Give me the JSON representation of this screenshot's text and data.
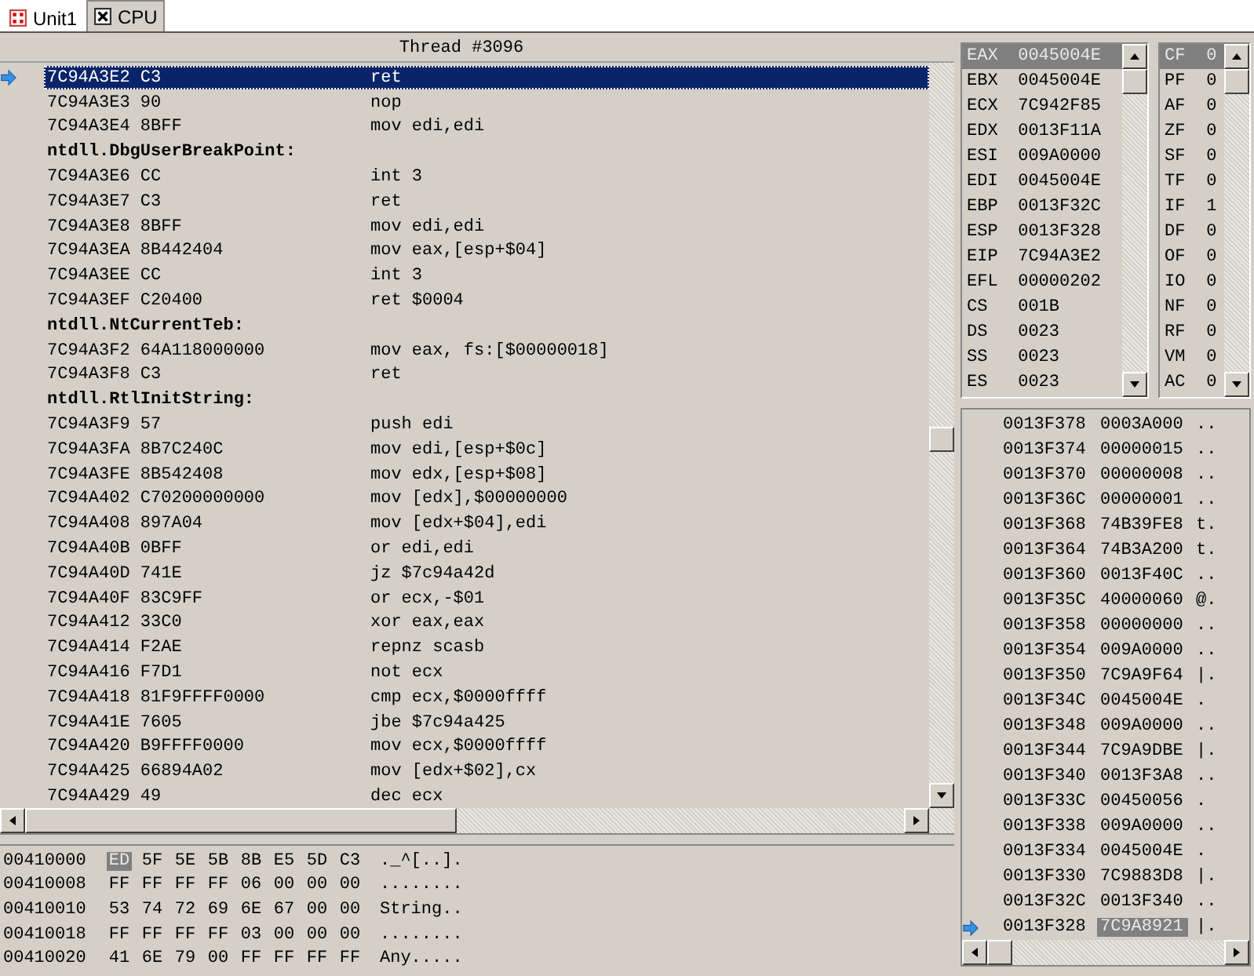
{
  "tabs": [
    {
      "label": "Unit1",
      "kind": "unit",
      "selected": false
    },
    {
      "label": "CPU",
      "kind": "cpu",
      "selected": true
    }
  ],
  "disassembly": {
    "title": "Thread #3096",
    "rows": [
      {
        "kind": "instr",
        "address": "7C94A3E2",
        "bytes": "C3",
        "instruction": "ret",
        "current": true,
        "selected": true
      },
      {
        "kind": "instr",
        "address": "7C94A3E3",
        "bytes": "90",
        "instruction": "nop",
        "current": false,
        "selected": false
      },
      {
        "kind": "instr",
        "address": "7C94A3E4",
        "bytes": "8BFF",
        "instruction": "mov edi,edi",
        "current": false,
        "selected": false
      },
      {
        "kind": "label",
        "text": "ntdll.DbgUserBreakPoint:",
        "current": false,
        "selected": false
      },
      {
        "kind": "instr",
        "address": "7C94A3E6",
        "bytes": "CC",
        "instruction": "int 3",
        "current": false,
        "selected": false
      },
      {
        "kind": "instr",
        "address": "7C94A3E7",
        "bytes": "C3",
        "instruction": "ret",
        "current": false,
        "selected": false
      },
      {
        "kind": "instr",
        "address": "7C94A3E8",
        "bytes": "8BFF",
        "instruction": "mov edi,edi",
        "current": false,
        "selected": false
      },
      {
        "kind": "instr",
        "address": "7C94A3EA",
        "bytes": "8B442404",
        "instruction": "mov eax,[esp+$04]",
        "current": false,
        "selected": false
      },
      {
        "kind": "instr",
        "address": "7C94A3EE",
        "bytes": "CC",
        "instruction": "int 3",
        "current": false,
        "selected": false
      },
      {
        "kind": "instr",
        "address": "7C94A3EF",
        "bytes": "C20400",
        "instruction": "ret $0004",
        "current": false,
        "selected": false
      },
      {
        "kind": "label",
        "text": "ntdll.NtCurrentTeb:",
        "current": false,
        "selected": false
      },
      {
        "kind": "instr",
        "address": "7C94A3F2",
        "bytes": "64A118000000",
        "instruction": "mov eax, fs:[$00000018]",
        "current": false,
        "selected": false
      },
      {
        "kind": "instr",
        "address": "7C94A3F8",
        "bytes": "C3",
        "instruction": "ret",
        "current": false,
        "selected": false
      },
      {
        "kind": "label",
        "text": "ntdll.RtlInitString:",
        "current": false,
        "selected": false
      },
      {
        "kind": "instr",
        "address": "7C94A3F9",
        "bytes": "57",
        "instruction": "push edi",
        "current": false,
        "selected": false
      },
      {
        "kind": "instr",
        "address": "7C94A3FA",
        "bytes": "8B7C240C",
        "instruction": "mov edi,[esp+$0c]",
        "current": false,
        "selected": false
      },
      {
        "kind": "instr",
        "address": "7C94A3FE",
        "bytes": "8B542408",
        "instruction": "mov edx,[esp+$08]",
        "current": false,
        "selected": false
      },
      {
        "kind": "instr",
        "address": "7C94A402",
        "bytes": "C70200000000",
        "instruction": "mov [edx],$00000000",
        "current": false,
        "selected": false
      },
      {
        "kind": "instr",
        "address": "7C94A408",
        "bytes": "897A04",
        "instruction": "mov [edx+$04],edi",
        "current": false,
        "selected": false
      },
      {
        "kind": "instr",
        "address": "7C94A40B",
        "bytes": "0BFF",
        "instruction": "or edi,edi",
        "current": false,
        "selected": false
      },
      {
        "kind": "instr",
        "address": "7C94A40D",
        "bytes": "741E",
        "instruction": "jz $7c94a42d",
        "current": false,
        "selected": false
      },
      {
        "kind": "instr",
        "address": "7C94A40F",
        "bytes": "83C9FF",
        "instruction": "or ecx,-$01",
        "current": false,
        "selected": false
      },
      {
        "kind": "instr",
        "address": "7C94A412",
        "bytes": "33C0",
        "instruction": "xor eax,eax",
        "current": false,
        "selected": false
      },
      {
        "kind": "instr",
        "address": "7C94A414",
        "bytes": "F2AE",
        "instruction": "repnz scasb",
        "current": false,
        "selected": false
      },
      {
        "kind": "instr",
        "address": "7C94A416",
        "bytes": "F7D1",
        "instruction": "not ecx",
        "current": false,
        "selected": false
      },
      {
        "kind": "instr",
        "address": "7C94A418",
        "bytes": "81F9FFFF0000",
        "instruction": "cmp ecx,$0000ffff",
        "current": false,
        "selected": false
      },
      {
        "kind": "instr",
        "address": "7C94A41E",
        "bytes": "7605",
        "instruction": "jbe $7c94a425",
        "current": false,
        "selected": false
      },
      {
        "kind": "instr",
        "address": "7C94A420",
        "bytes": "B9FFFF0000",
        "instruction": "mov ecx,$0000ffff",
        "current": false,
        "selected": false
      },
      {
        "kind": "instr",
        "address": "7C94A425",
        "bytes": "66894A02",
        "instruction": "mov [edx+$02],cx",
        "current": false,
        "selected": false
      },
      {
        "kind": "instr",
        "address": "7C94A429",
        "bytes": "49",
        "instruction": "dec ecx",
        "current": false,
        "selected": false
      }
    ]
  },
  "registers": [
    {
      "name": "EAX",
      "value": "0045004E",
      "selected": true
    },
    {
      "name": "EBX",
      "value": "0045004E",
      "selected": false
    },
    {
      "name": "ECX",
      "value": "7C942F85",
      "selected": false
    },
    {
      "name": "EDX",
      "value": "0013F11A",
      "selected": false
    },
    {
      "name": "ESI",
      "value": "009A0000",
      "selected": false
    },
    {
      "name": "EDI",
      "value": "0045004E",
      "selected": false
    },
    {
      "name": "EBP",
      "value": "0013F32C",
      "selected": false
    },
    {
      "name": "ESP",
      "value": "0013F328",
      "selected": false
    },
    {
      "name": "EIP",
      "value": "7C94A3E2",
      "selected": false
    },
    {
      "name": "EFL",
      "value": "00000202",
      "selected": false
    },
    {
      "name": "CS",
      "value": "001B",
      "selected": false
    },
    {
      "name": "DS",
      "value": "0023",
      "selected": false
    },
    {
      "name": "SS",
      "value": "0023",
      "selected": false
    },
    {
      "name": "ES",
      "value": "0023",
      "selected": false
    }
  ],
  "flags": [
    {
      "name": "CF",
      "value": "0",
      "selected": true
    },
    {
      "name": "PF",
      "value": "0",
      "selected": false
    },
    {
      "name": "AF",
      "value": "0",
      "selected": false
    },
    {
      "name": "ZF",
      "value": "0",
      "selected": false
    },
    {
      "name": "SF",
      "value": "0",
      "selected": false
    },
    {
      "name": "TF",
      "value": "0",
      "selected": false
    },
    {
      "name": "IF",
      "value": "1",
      "selected": false
    },
    {
      "name": "DF",
      "value": "0",
      "selected": false
    },
    {
      "name": "OF",
      "value": "0",
      "selected": false
    },
    {
      "name": "IO",
      "value": "0",
      "selected": false
    },
    {
      "name": "NF",
      "value": "0",
      "selected": false
    },
    {
      "name": "RF",
      "value": "0",
      "selected": false
    },
    {
      "name": "VM",
      "value": "0",
      "selected": false
    },
    {
      "name": "AC",
      "value": "0",
      "selected": false
    }
  ],
  "stack": [
    {
      "address": "0013F378",
      "value": "0003A000",
      "ascii": "..",
      "current": false,
      "selected": false
    },
    {
      "address": "0013F374",
      "value": "00000015",
      "ascii": "..",
      "current": false,
      "selected": false
    },
    {
      "address": "0013F370",
      "value": "00000008",
      "ascii": "..",
      "current": false,
      "selected": false
    },
    {
      "address": "0013F36C",
      "value": "00000001",
      "ascii": "..",
      "current": false,
      "selected": false
    },
    {
      "address": "0013F368",
      "value": "74B39FE8",
      "ascii": "t.",
      "current": false,
      "selected": false
    },
    {
      "address": "0013F364",
      "value": "74B3A200",
      "ascii": "t.",
      "current": false,
      "selected": false
    },
    {
      "address": "0013F360",
      "value": "0013F40C",
      "ascii": "..",
      "current": false,
      "selected": false
    },
    {
      "address": "0013F35C",
      "value": "40000060",
      "ascii": "@.",
      "current": false,
      "selected": false
    },
    {
      "address": "0013F358",
      "value": "00000000",
      "ascii": "..",
      "current": false,
      "selected": false
    },
    {
      "address": "0013F354",
      "value": "009A0000",
      "ascii": "..",
      "current": false,
      "selected": false
    },
    {
      "address": "0013F350",
      "value": "7C9A9F64",
      "ascii": "|.",
      "current": false,
      "selected": false
    },
    {
      "address": "0013F34C",
      "value": "0045004E",
      "ascii": ".",
      "current": false,
      "selected": false
    },
    {
      "address": "0013F348",
      "value": "009A0000",
      "ascii": "..",
      "current": false,
      "selected": false
    },
    {
      "address": "0013F344",
      "value": "7C9A9DBE",
      "ascii": "|.",
      "current": false,
      "selected": false
    },
    {
      "address": "0013F340",
      "value": "0013F3A8",
      "ascii": "..",
      "current": false,
      "selected": false
    },
    {
      "address": "0013F33C",
      "value": "00450056",
      "ascii": ".",
      "current": false,
      "selected": false
    },
    {
      "address": "0013F338",
      "value": "009A0000",
      "ascii": "..",
      "current": false,
      "selected": false
    },
    {
      "address": "0013F334",
      "value": "0045004E",
      "ascii": ".",
      "current": false,
      "selected": false
    },
    {
      "address": "0013F330",
      "value": "7C9883D8",
      "ascii": "|.",
      "current": false,
      "selected": false
    },
    {
      "address": "0013F32C",
      "value": "0013F340",
      "ascii": "..",
      "current": false,
      "selected": false
    },
    {
      "address": "0013F328",
      "value": "7C9A8921",
      "ascii": "|.",
      "current": true,
      "selected": true
    }
  ],
  "memory_dump": [
    {
      "address": "00410000",
      "bytes": [
        {
          "text": "ED",
          "selected": true
        },
        {
          "text": "5F",
          "selected": false
        },
        {
          "text": "5E",
          "selected": false
        },
        {
          "text": "5B",
          "selected": false
        },
        {
          "text": "8B",
          "selected": false
        },
        {
          "text": "E5",
          "selected": false
        },
        {
          "text": "5D",
          "selected": false
        },
        {
          "text": "C3",
          "selected": false
        }
      ],
      "ascii": "._^[..]."
    },
    {
      "address": "00410008",
      "bytes": [
        {
          "text": "FF",
          "selected": false
        },
        {
          "text": "FF",
          "selected": false
        },
        {
          "text": "FF",
          "selected": false
        },
        {
          "text": "FF",
          "selected": false
        },
        {
          "text": "06",
          "selected": false
        },
        {
          "text": "00",
          "selected": false
        },
        {
          "text": "00",
          "selected": false
        },
        {
          "text": "00",
          "selected": false
        }
      ],
      "ascii": "........"
    },
    {
      "address": "00410010",
      "bytes": [
        {
          "text": "53",
          "selected": false
        },
        {
          "text": "74",
          "selected": false
        },
        {
          "text": "72",
          "selected": false
        },
        {
          "text": "69",
          "selected": false
        },
        {
          "text": "6E",
          "selected": false
        },
        {
          "text": "67",
          "selected": false
        },
        {
          "text": "00",
          "selected": false
        },
        {
          "text": "00",
          "selected": false
        }
      ],
      "ascii": "String.."
    },
    {
      "address": "00410018",
      "bytes": [
        {
          "text": "FF",
          "selected": false
        },
        {
          "text": "FF",
          "selected": false
        },
        {
          "text": "FF",
          "selected": false
        },
        {
          "text": "FF",
          "selected": false
        },
        {
          "text": "03",
          "selected": false
        },
        {
          "text": "00",
          "selected": false
        },
        {
          "text": "00",
          "selected": false
        },
        {
          "text": "00",
          "selected": false
        }
      ],
      "ascii": "........"
    },
    {
      "address": "00410020",
      "bytes": [
        {
          "text": "41",
          "selected": false
        },
        {
          "text": "6E",
          "selected": false
        },
        {
          "text": "79",
          "selected": false
        },
        {
          "text": "00",
          "selected": false
        },
        {
          "text": "FF",
          "selected": false
        },
        {
          "text": "FF",
          "selected": false
        },
        {
          "text": "FF",
          "selected": false
        },
        {
          "text": "FF",
          "selected": false
        }
      ],
      "ascii": "Any....."
    }
  ]
}
